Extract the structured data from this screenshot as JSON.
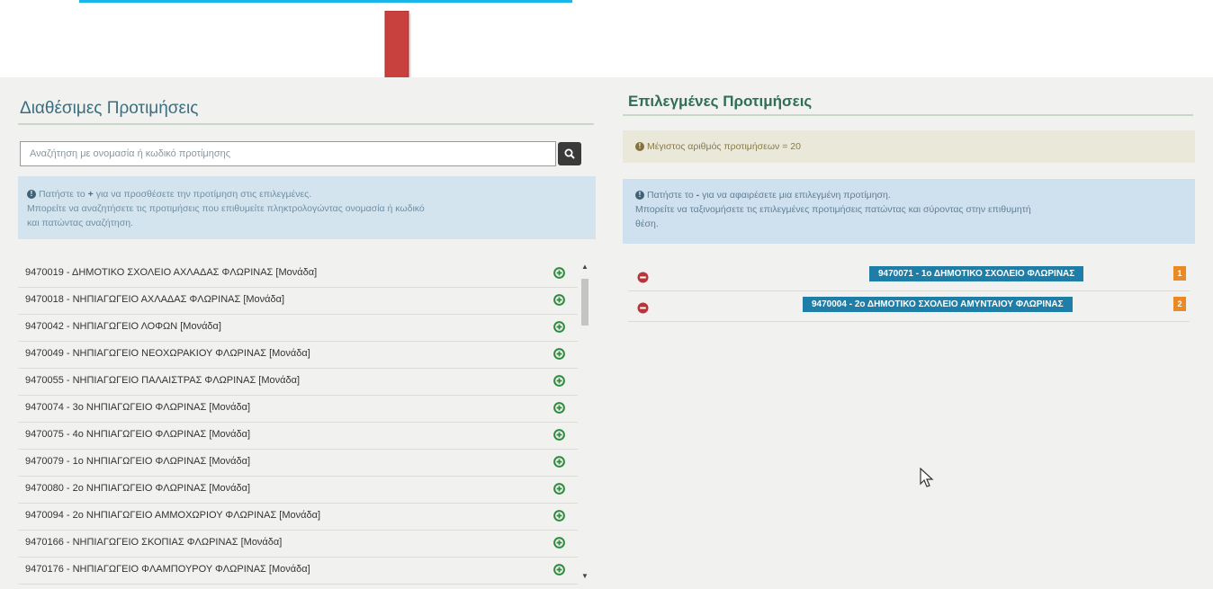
{
  "available": {
    "title": "Διαθέσιμες Προτιμήσεις",
    "search_placeholder": "Αναζήτηση με ονομασία ή κωδικό προτίμησης",
    "info_line1_a": "Πατήστε το",
    "info_line1_b": "για να προσθέσετε την προτίμηση στις επιλεγμένες.",
    "info_line2": "Μπορείτε να αναζητήσετε τις προτιμήσεις που επιθυμείτε πληκτρολογώντας ονομασία ή κωδικό",
    "info_line3": "και πατώντας αναζήτηση.",
    "items": [
      {
        "label": "9470019 - ΔΗΜΟΤΙΚΟ ΣΧΟΛΕΙΟ ΑΧΛΑΔΑΣ ΦΛΩΡΙΝΑΣ [Μονάδα]"
      },
      {
        "label": "9470018 - ΝΗΠΙΑΓΩΓΕΙΟ ΑΧΛΑΔΑΣ ΦΛΩΡΙΝΑΣ [Μονάδα]"
      },
      {
        "label": "9470042 - ΝΗΠΙΑΓΩΓΕΙΟ ΛΟΦΩΝ [Μονάδα]"
      },
      {
        "label": "9470049 - ΝΗΠΙΑΓΩΓΕΙΟ ΝΕΟΧΩΡΑΚΙΟΥ ΦΛΩΡΙΝΑΣ [Μονάδα]"
      },
      {
        "label": "9470055 - ΝΗΠΙΑΓΩΓΕΙΟ ΠΑΛΑΙΣΤΡΑΣ ΦΛΩΡΙΝΑΣ [Μονάδα]"
      },
      {
        "label": "9470074 - 3ο ΝΗΠΙΑΓΩΓΕΙΟ ΦΛΩΡΙΝΑΣ [Μονάδα]"
      },
      {
        "label": "9470075 - 4ο ΝΗΠΙΑΓΩΓΕΙΟ ΦΛΩΡΙΝΑΣ [Μονάδα]"
      },
      {
        "label": "9470079 - 1ο ΝΗΠΙΑΓΩΓΕΙΟ ΦΛΩΡΙΝΑΣ [Μονάδα]"
      },
      {
        "label": "9470080 - 2ο ΝΗΠΙΑΓΩΓΕΙΟ ΦΛΩΡΙΝΑΣ [Μονάδα]"
      },
      {
        "label": "9470094 - 2ο ΝΗΠΙΑΓΩΓΕΙΟ ΑΜΜΟΧΩΡΙΟΥ ΦΛΩΡΙΝΑΣ [Μονάδα]"
      },
      {
        "label": "9470166 - ΝΗΠΙΑΓΩΓΕΙΟ ΣΚΟΠΙΑΣ ΦΛΩΡΙΝΑΣ [Μονάδα]"
      },
      {
        "label": "9470176 - ΝΗΠΙΑΓΩΓΕΙΟ ΦΛΑΜΠΟΥΡΟΥ ΦΛΩΡΙΝΑΣ [Μονάδα]"
      }
    ]
  },
  "selected": {
    "title": "Επιλεγμένες Προτιμήσεις",
    "max_notice": "Μέγιστος αριθμός προτιμήσεων = 20",
    "info_line1_a": "Πατήστε το",
    "info_line1_b": "για να αφαιρέσετε μια επιλεγμένη προτίμηση.",
    "info_line2": "Μπορείτε να ταξινομήσετε τις επιλεγμένες προτιμήσεις πατώντας και σύροντας στην επιθυμητή",
    "info_line3": "θέση.",
    "items": [
      {
        "label": "9470071 - 1ο ΔΗΜΟΤΙΚΟ ΣΧΟΛΕΙΟ ΦΛΩΡΙΝΑΣ",
        "order": "1"
      },
      {
        "label": "9470004 - 2ο ΔΗΜΟΤΙΚΟ ΣΧΟΛΕΙΟ ΑΜΥΝΤΑΙΟΥ ΦΛΩΡΙΝΑΣ",
        "order": "2"
      }
    ]
  },
  "colors": {
    "annotation_line": "#19b6ea",
    "annotation_arrow": "#c8413f",
    "selected_label_bg": "#1f7ea7",
    "order_badge": "#e98a25",
    "add_icon": "#2e8b3d",
    "remove_icon": "#b8363a"
  },
  "icons": {
    "search": "search-icon",
    "add": "plus-circle-icon",
    "remove": "minus-circle-icon",
    "info": "info-icon",
    "pointer": "mouse-cursor-icon",
    "annotation": "arrow-down-icon"
  }
}
